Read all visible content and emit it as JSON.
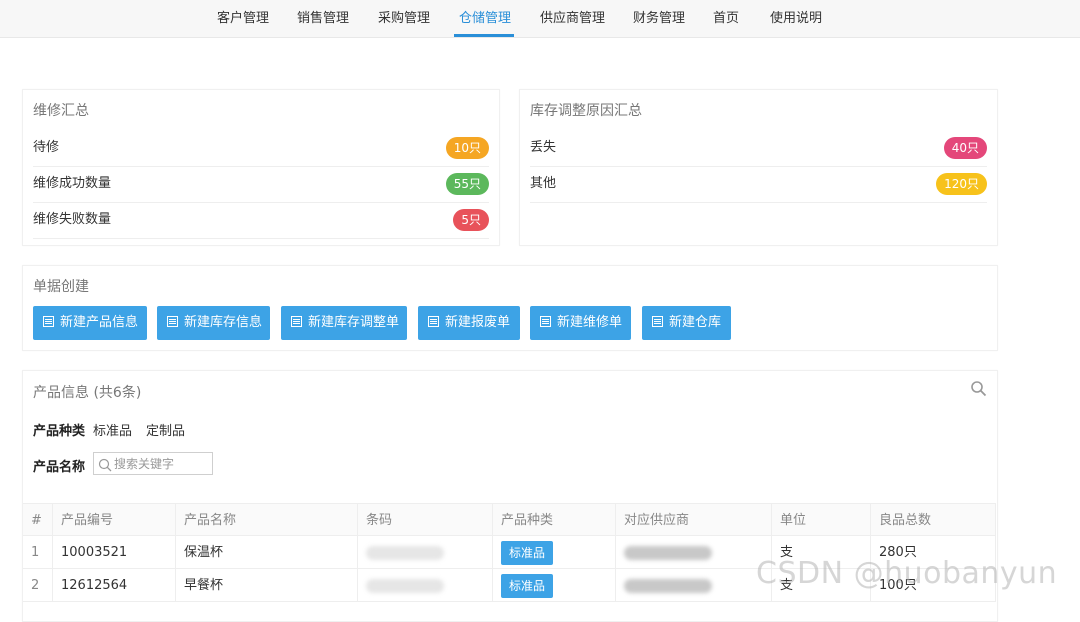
{
  "nav": {
    "items": [
      "客户管理",
      "销售管理",
      "采购管理",
      "仓储管理",
      "供应商管理",
      "财务管理",
      "首页",
      "使用说明"
    ],
    "active": "仓储管理",
    "accent": "#2a8fd8"
  },
  "repair": {
    "title": "维修汇总",
    "rows": [
      {
        "label": "待修",
        "badge": "10只",
        "color": "#f5a623"
      },
      {
        "label": "维修成功数量",
        "badge": "55只",
        "color": "#5cb85c"
      },
      {
        "label": "维修失败数量",
        "badge": "5只",
        "color": "#e8525a"
      }
    ]
  },
  "adjust": {
    "title": "库存调整原因汇总",
    "rows": [
      {
        "label": "丢失",
        "badge": "40只",
        "color": "#e4477a"
      },
      {
        "label": "其他",
        "badge": "120只",
        "color": "#f7c21b"
      }
    ]
  },
  "create": {
    "title": "单据创建",
    "buttons": [
      "新建产品信息",
      "新建库存信息",
      "新建库存调整单",
      "新建报废单",
      "新建维修单",
      "新建仓库"
    ],
    "icon": "document-icon",
    "color": "#3da3e6"
  },
  "products": {
    "title": "产品信息 (共6条)",
    "search_icon": "search-icon",
    "filter_type_label": "产品种类",
    "filter_type_options": [
      "标准品",
      "定制品"
    ],
    "filter_name_label": "产品名称",
    "search_placeholder": "搜索关键字",
    "columns": [
      "#",
      "产品编号",
      "产品名称",
      "条码",
      "产品种类",
      "对应供应商",
      "单位",
      "良品总数"
    ],
    "rows": [
      {
        "index": "1",
        "code": "10003521",
        "name": "保温杯",
        "type": "标准品",
        "unit": "支",
        "total": "280只"
      },
      {
        "index": "2",
        "code": "12612564",
        "name": "早餐杯",
        "type": "标准品",
        "unit": "支",
        "total": "100只"
      }
    ]
  },
  "watermark": "CSDN @huobanyun"
}
